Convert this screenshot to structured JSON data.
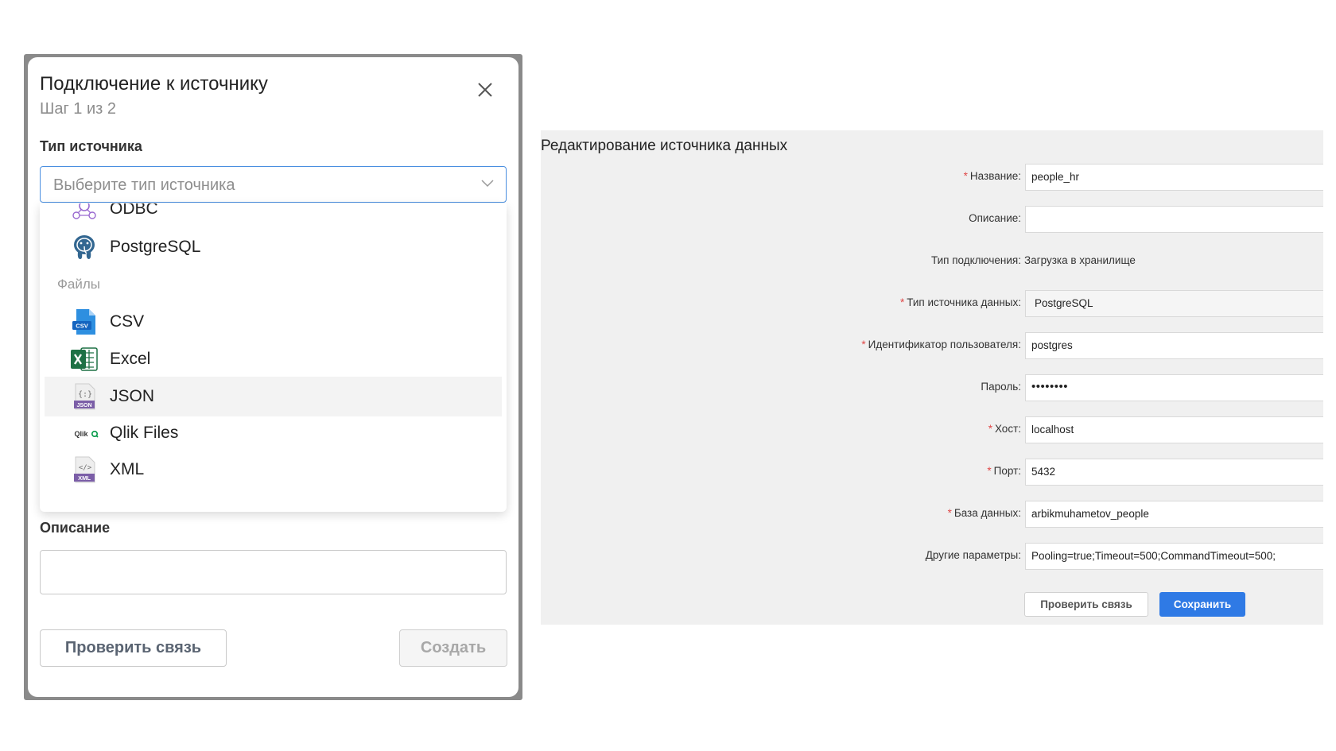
{
  "dialog": {
    "title": "Подключение к источнику",
    "step": "Шаг 1 из 2",
    "source_type_label": "Тип источника",
    "source_type_placeholder": "Выберите тип источника",
    "dropdown": {
      "items_top": [
        {
          "label": "ODBC",
          "icon": "odbc-icon"
        },
        {
          "label": "PostgreSQL",
          "icon": "postgresql-icon"
        }
      ],
      "group_files": "Файлы",
      "items_files": [
        {
          "label": "CSV",
          "icon": "csv-file-icon"
        },
        {
          "label": "Excel",
          "icon": "excel-file-icon"
        },
        {
          "label": "JSON",
          "icon": "json-file-icon",
          "highlighted": true
        },
        {
          "label": "Qlik Files",
          "icon": "qlik-icon"
        },
        {
          "label": "XML",
          "icon": "xml-file-icon"
        }
      ]
    },
    "description_label": "Описание",
    "check_button": "Проверить связь",
    "create_button": "Создать"
  },
  "panel": {
    "title": "Редактирование источника данных",
    "fields": [
      {
        "label": "Название:",
        "required": true,
        "value": "people_hr"
      },
      {
        "label": "Описание:",
        "required": false,
        "value": ""
      },
      {
        "label": "Тип подключения:",
        "required": false,
        "value": "Загрузка в хранилище"
      },
      {
        "label": "Тип источника данных:",
        "required": true,
        "value": "PostgreSQL"
      },
      {
        "label": "Идентификатор пользователя:",
        "required": true,
        "value": "postgres"
      },
      {
        "label": "Пароль:",
        "required": false,
        "value": "••••••••"
      },
      {
        "label": "Хост:",
        "required": true,
        "value": "localhost"
      },
      {
        "label": "Порт:",
        "required": true,
        "value": "5432"
      },
      {
        "label": "База данных:",
        "required": true,
        "value": "arbikmuhametov_people"
      },
      {
        "label": "Другие параметры:",
        "required": false,
        "value": "Pooling=true;Timeout=500;CommandTimeout=500;"
      }
    ],
    "required_marker": "*",
    "check_button": "Проверить связь",
    "save_button": "Сохранить"
  },
  "colors": {
    "accent": "#2f7ae5",
    "select_border": "#4a8fe0",
    "required": "#e04848",
    "panel_bg": "#f0f0f0"
  }
}
